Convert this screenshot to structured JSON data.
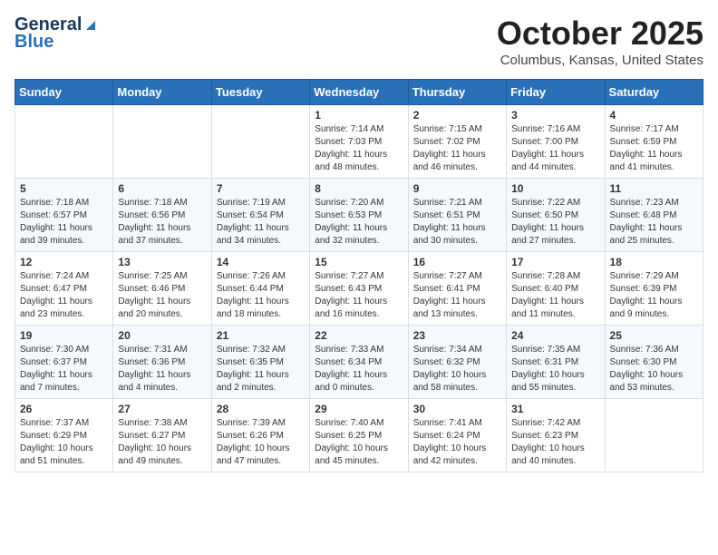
{
  "header": {
    "logo_general": "General",
    "logo_blue": "Blue",
    "month_title": "October 2025",
    "location": "Columbus, Kansas, United States"
  },
  "days_of_week": [
    "Sunday",
    "Monday",
    "Tuesday",
    "Wednesday",
    "Thursday",
    "Friday",
    "Saturday"
  ],
  "weeks": [
    [
      {
        "day": "",
        "info": ""
      },
      {
        "day": "",
        "info": ""
      },
      {
        "day": "",
        "info": ""
      },
      {
        "day": "1",
        "info": "Sunrise: 7:14 AM\nSunset: 7:03 PM\nDaylight: 11 hours\nand 48 minutes."
      },
      {
        "day": "2",
        "info": "Sunrise: 7:15 AM\nSunset: 7:02 PM\nDaylight: 11 hours\nand 46 minutes."
      },
      {
        "day": "3",
        "info": "Sunrise: 7:16 AM\nSunset: 7:00 PM\nDaylight: 11 hours\nand 44 minutes."
      },
      {
        "day": "4",
        "info": "Sunrise: 7:17 AM\nSunset: 6:59 PM\nDaylight: 11 hours\nand 41 minutes."
      }
    ],
    [
      {
        "day": "5",
        "info": "Sunrise: 7:18 AM\nSunset: 6:57 PM\nDaylight: 11 hours\nand 39 minutes."
      },
      {
        "day": "6",
        "info": "Sunrise: 7:18 AM\nSunset: 6:56 PM\nDaylight: 11 hours\nand 37 minutes."
      },
      {
        "day": "7",
        "info": "Sunrise: 7:19 AM\nSunset: 6:54 PM\nDaylight: 11 hours\nand 34 minutes."
      },
      {
        "day": "8",
        "info": "Sunrise: 7:20 AM\nSunset: 6:53 PM\nDaylight: 11 hours\nand 32 minutes."
      },
      {
        "day": "9",
        "info": "Sunrise: 7:21 AM\nSunset: 6:51 PM\nDaylight: 11 hours\nand 30 minutes."
      },
      {
        "day": "10",
        "info": "Sunrise: 7:22 AM\nSunset: 6:50 PM\nDaylight: 11 hours\nand 27 minutes."
      },
      {
        "day": "11",
        "info": "Sunrise: 7:23 AM\nSunset: 6:48 PM\nDaylight: 11 hours\nand 25 minutes."
      }
    ],
    [
      {
        "day": "12",
        "info": "Sunrise: 7:24 AM\nSunset: 6:47 PM\nDaylight: 11 hours\nand 23 minutes."
      },
      {
        "day": "13",
        "info": "Sunrise: 7:25 AM\nSunset: 6:46 PM\nDaylight: 11 hours\nand 20 minutes."
      },
      {
        "day": "14",
        "info": "Sunrise: 7:26 AM\nSunset: 6:44 PM\nDaylight: 11 hours\nand 18 minutes."
      },
      {
        "day": "15",
        "info": "Sunrise: 7:27 AM\nSunset: 6:43 PM\nDaylight: 11 hours\nand 16 minutes."
      },
      {
        "day": "16",
        "info": "Sunrise: 7:27 AM\nSunset: 6:41 PM\nDaylight: 11 hours\nand 13 minutes."
      },
      {
        "day": "17",
        "info": "Sunrise: 7:28 AM\nSunset: 6:40 PM\nDaylight: 11 hours\nand 11 minutes."
      },
      {
        "day": "18",
        "info": "Sunrise: 7:29 AM\nSunset: 6:39 PM\nDaylight: 11 hours\nand 9 minutes."
      }
    ],
    [
      {
        "day": "19",
        "info": "Sunrise: 7:30 AM\nSunset: 6:37 PM\nDaylight: 11 hours\nand 7 minutes."
      },
      {
        "day": "20",
        "info": "Sunrise: 7:31 AM\nSunset: 6:36 PM\nDaylight: 11 hours\nand 4 minutes."
      },
      {
        "day": "21",
        "info": "Sunrise: 7:32 AM\nSunset: 6:35 PM\nDaylight: 11 hours\nand 2 minutes."
      },
      {
        "day": "22",
        "info": "Sunrise: 7:33 AM\nSunset: 6:34 PM\nDaylight: 11 hours\nand 0 minutes."
      },
      {
        "day": "23",
        "info": "Sunrise: 7:34 AM\nSunset: 6:32 PM\nDaylight: 10 hours\nand 58 minutes."
      },
      {
        "day": "24",
        "info": "Sunrise: 7:35 AM\nSunset: 6:31 PM\nDaylight: 10 hours\nand 55 minutes."
      },
      {
        "day": "25",
        "info": "Sunrise: 7:36 AM\nSunset: 6:30 PM\nDaylight: 10 hours\nand 53 minutes."
      }
    ],
    [
      {
        "day": "26",
        "info": "Sunrise: 7:37 AM\nSunset: 6:29 PM\nDaylight: 10 hours\nand 51 minutes."
      },
      {
        "day": "27",
        "info": "Sunrise: 7:38 AM\nSunset: 6:27 PM\nDaylight: 10 hours\nand 49 minutes."
      },
      {
        "day": "28",
        "info": "Sunrise: 7:39 AM\nSunset: 6:26 PM\nDaylight: 10 hours\nand 47 minutes."
      },
      {
        "day": "29",
        "info": "Sunrise: 7:40 AM\nSunset: 6:25 PM\nDaylight: 10 hours\nand 45 minutes."
      },
      {
        "day": "30",
        "info": "Sunrise: 7:41 AM\nSunset: 6:24 PM\nDaylight: 10 hours\nand 42 minutes."
      },
      {
        "day": "31",
        "info": "Sunrise: 7:42 AM\nSunset: 6:23 PM\nDaylight: 10 hours\nand 40 minutes."
      },
      {
        "day": "",
        "info": ""
      }
    ]
  ]
}
